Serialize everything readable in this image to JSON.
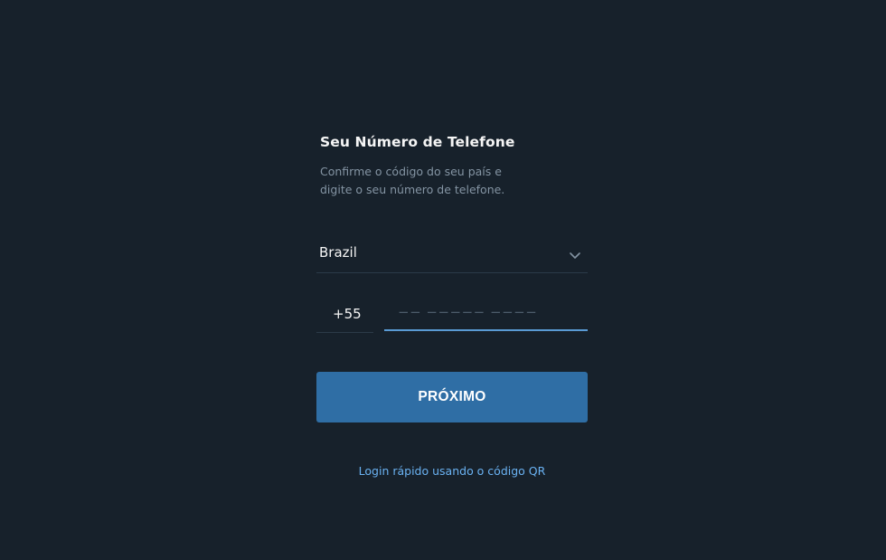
{
  "login": {
    "title": "Seu Número de Telefone",
    "subtitle": "Confirme o código do seu país e digite o seu número de telefone.",
    "country": {
      "value": "Brazil",
      "icon": "chevron-down-icon"
    },
    "phone": {
      "country_code": "+55",
      "value": "",
      "placeholder": "−− −−−−− −−−−"
    },
    "next_button_label": "PRÓXIMO",
    "qr_login_link": "Login rápido usando o código QR"
  },
  "colors": {
    "background": "#17212b",
    "primary_text": "#f5f5f5",
    "secondary_text": "#8494a3",
    "accent": "#2f6ea5",
    "link": "#6ab2f2",
    "active_underline": "#5a9bd5"
  }
}
